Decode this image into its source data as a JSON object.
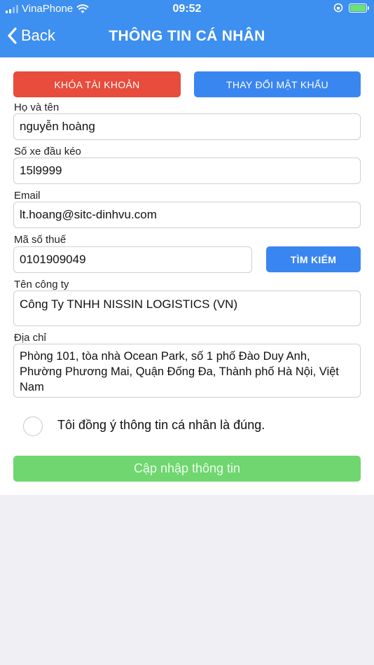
{
  "status_bar": {
    "carrier": "VinaPhone",
    "time": "09:52"
  },
  "nav": {
    "back_label": "Back",
    "title": "THÔNG TIN CÁ NHÂN"
  },
  "actions": {
    "lock_account": "KHÓA TÀI KHOẢN",
    "change_password": "THAY ĐỔI MẬT KHẨU",
    "search": "TÌM KIẾM"
  },
  "form": {
    "full_name": {
      "label": "Họ và tên",
      "value": "nguyễn hoàng"
    },
    "tractor_plate": {
      "label": "Số xe đầu kéo",
      "value": "15l9999"
    },
    "email": {
      "label": "Email",
      "value": "lt.hoang@sitc-dinhvu.com"
    },
    "tax_code": {
      "label": "Mã số thuế",
      "value": "0101909049"
    },
    "company": {
      "label": "Tên công ty",
      "value": "Công Ty TNHH NISSIN LOGISTICS (VN)"
    },
    "address": {
      "label": "Địa chỉ",
      "value": "Phòng 101, tòa nhà Ocean Park, số 1 phố Đào Duy Anh, Phường Phương Mai, Quận Đống Đa, Thành phố Hà Nội, Việt Nam"
    }
  },
  "agreement": {
    "text": "Tôi đồng ý thông tin cá nhân là đúng.",
    "checked": false
  },
  "submit_label": "Cập nhập thông tin",
  "colors": {
    "header": "#3d8ff0",
    "danger": "#e74c3c",
    "primary": "#3a86f0",
    "success": "#6fd670"
  }
}
